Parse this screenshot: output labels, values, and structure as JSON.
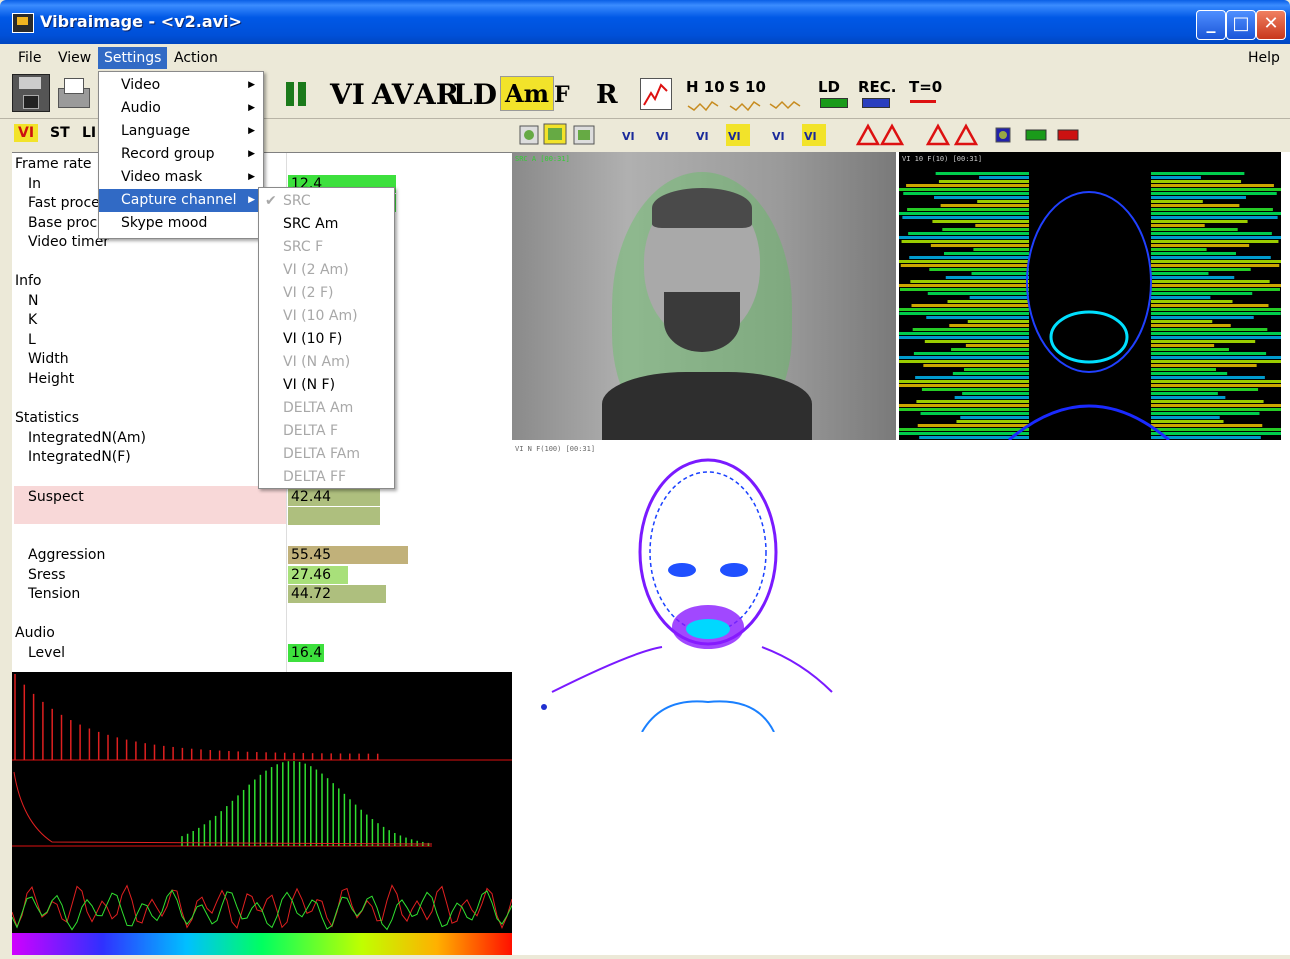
{
  "window": {
    "title": "Vibraimage - <v2.avi>"
  },
  "menubar": {
    "items": [
      "File",
      "View",
      "Settings",
      "Action"
    ],
    "help": "Help"
  },
  "toolbar1": {
    "labels": [
      "VI",
      "AV",
      "AR",
      "LD",
      "Am",
      "F",
      "R",
      "H 10",
      "S 10",
      "LD",
      "REC.",
      "T=0"
    ]
  },
  "toolbar2": {
    "labels": [
      "VI",
      "ST",
      "LI"
    ]
  },
  "settings_menu": {
    "items": [
      "Video",
      "Audio",
      "Language",
      "Record group",
      "Video mask",
      "Capture channel",
      "Skype mood"
    ]
  },
  "capture_menu": {
    "items": [
      "SRC",
      "SRC Am",
      "SRC F",
      "VI (2 Am)",
      "VI (2 F)",
      "VI (10 Am)",
      "VI (10 F)",
      "VI (N Am)",
      "VI (N F)",
      "DELTA Am",
      "DELTA F",
      "DELTA FAm",
      "DELTA FF"
    ],
    "enabled": [
      "SRC Am",
      "VI (10 F)",
      "VI (N F)"
    ],
    "checked": "SRC"
  },
  "stats": {
    "frame_rate": "Frame rate",
    "in": "In",
    "in_value": "12.4",
    "fast_proc": "Fast proce",
    "base_proc": "Base proc",
    "video_timer": "Video timer",
    "info": "Info",
    "n": "N",
    "k": "K",
    "l": "L",
    "width": "Width",
    "height": "Height",
    "statistics": "Statistics",
    "integrated_am": "IntegratedN(Am)",
    "integrated_f": "IntegratedN(F)",
    "suspect": "Suspect",
    "suspect_value": "42.44",
    "aggression": "Aggression",
    "aggression_value": "55.45",
    "stress": "Sress",
    "stress_value": "27.46",
    "tension": "Tension",
    "tension_value": "44.72",
    "audio": "Audio",
    "level": "Level",
    "level_value": "16.4"
  },
  "video_labels": {
    "src": "SRC A [00:31]",
    "vi10": "VI 10 F(10) [00:31]",
    "vin": "VI N F(100) [00:31]"
  },
  "colors": {
    "green_bar": "#3de03d",
    "olive_bar": "#aebf7e",
    "tan_bar": "#c1b17a",
    "suspect_bg": "#f8d8d8"
  }
}
